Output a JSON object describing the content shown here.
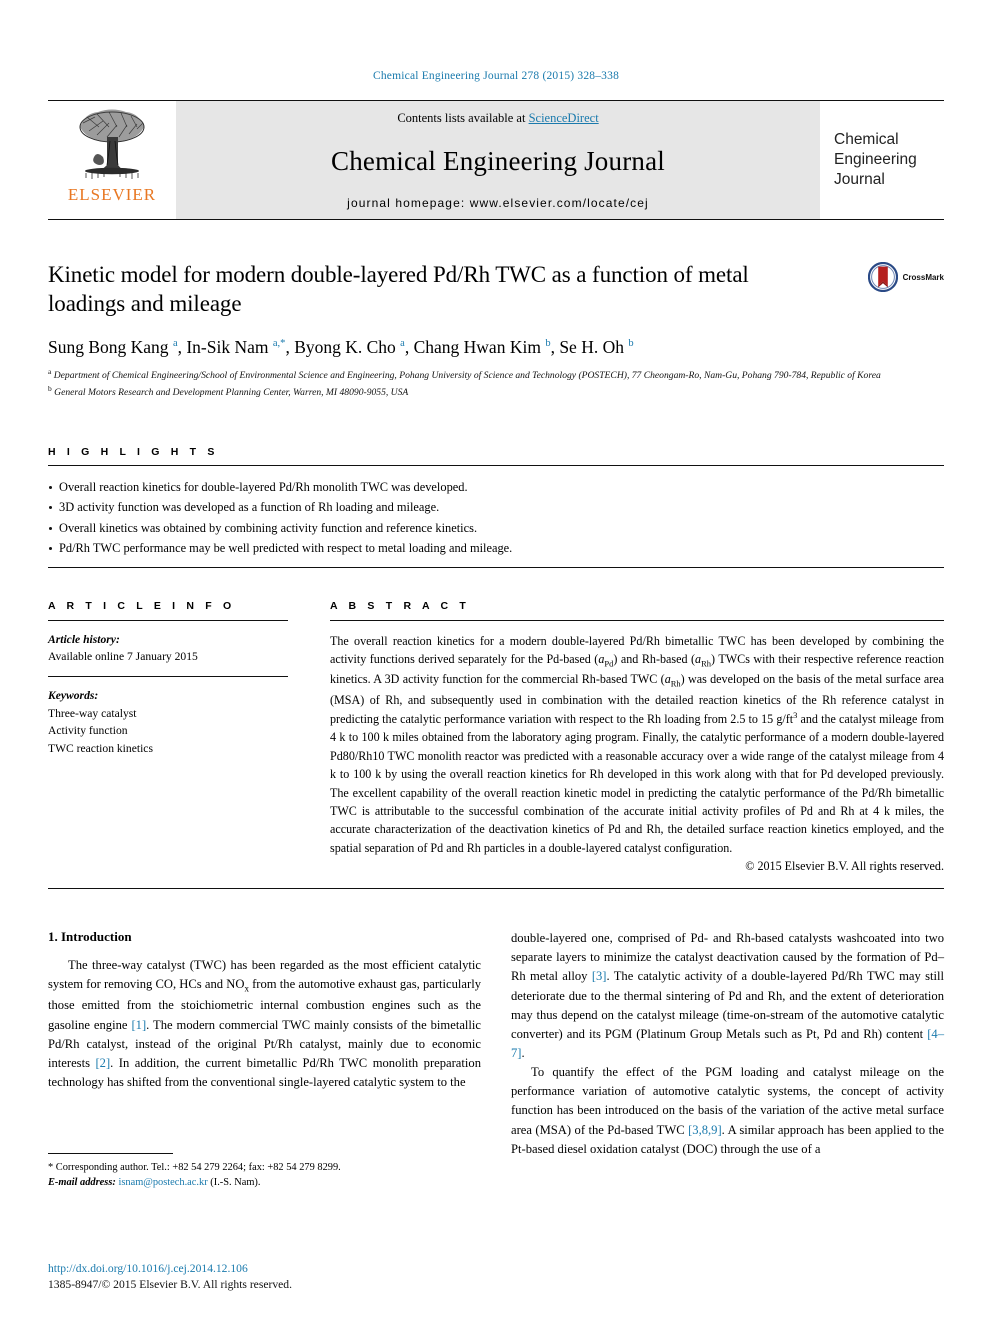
{
  "running_head": "Chemical Engineering Journal 278 (2015) 328–338",
  "masthead": {
    "contents_prefix": "Contents lists available at ",
    "sciencedirect": "ScienceDirect",
    "journal_title": "Chemical Engineering Journal",
    "homepage": "journal homepage: www.elsevier.com/locate/cej",
    "publisher": "ELSEVIER",
    "cover_lines": [
      "Chemical",
      "Engineering",
      "Journal"
    ]
  },
  "article": {
    "title": "Kinetic model for modern double-layered Pd/Rh TWC as a function of metal loadings and mileage",
    "crossmark_label": "CrossMark",
    "authors_html": "Sung Bong Kang <sup>a</sup>, In-Sik Nam <sup>a,*</sup>, Byong K. Cho <sup>a</sup>, Chang Hwan Kim <sup>b</sup>, Se H. Oh <sup>b</sup>",
    "affiliations": [
      "<sup>a</sup> Department of Chemical Engineering/School of Environmental Science and Engineering, Pohang University of Science and Technology (POSTECH), 77 Cheongam-Ro, Nam-Gu, Pohang 790-784, Republic of Korea",
      "<sup>b</sup> General Motors Research and Development Planning Center, Warren, MI 48090-9055, USA"
    ]
  },
  "highlights": {
    "heading": "H I G H L I G H T S",
    "items": [
      "Overall reaction kinetics for double-layered Pd/Rh monolith TWC was developed.",
      "3D activity function was developed as a function of Rh loading and mileage.",
      "Overall kinetics was obtained by combining activity function and reference kinetics.",
      "Pd/Rh TWC performance may be well predicted with respect to metal loading and mileage."
    ]
  },
  "article_info": {
    "heading": "A R T I C L E    I N F O",
    "history_label": "Article history:",
    "history_value": "Available online 7 January 2015",
    "keywords_label": "Keywords:",
    "keywords": [
      "Three-way catalyst",
      "Activity function",
      "TWC reaction kinetics"
    ]
  },
  "abstract": {
    "heading": "A B S T R A C T",
    "body_html": "The overall reaction kinetics for a modern double-layered Pd/Rh bimetallic TWC has been developed by combining the activity functions derived separately for the Pd-based (<i>a</i><sub>Pd</sub>) and Rh-based (<i>a</i><sub>Rh</sub>) TWCs with their respective reference reaction kinetics. A 3D activity function for the commercial Rh-based TWC (<i>a</i><sub>Rh</sub>) was developed on the basis of the metal surface area (MSA) of Rh, and subsequently used in combination with the detailed reaction kinetics of the Rh reference catalyst in predicting the catalytic performance variation with respect to the Rh loading from 2.5 to 15 g/ft<sup>3</sup> and the catalyst mileage from 4 k to 100 k miles obtained from the laboratory aging program. Finally, the catalytic performance of a modern double-layered Pd80/Rh10 TWC monolith reactor was predicted with a reasonable accuracy over a wide range of the catalyst mileage from 4 k to 100 k by using the overall reaction kinetics for Rh developed in this work along with that for Pd developed previously. The excellent capability of the overall reaction kinetic model in predicting the catalytic performance of the Pd/Rh bimetallic TWC is attributable to the successful combination of the accurate initial activity profiles of Pd and Rh at 4 k miles, the accurate characterization of the deactivation kinetics of Pd and Rh, the detailed surface reaction kinetics employed, and the spatial separation of Pd and Rh particles in a double-layered catalyst configuration.",
    "copyright": "© 2015 Elsevier B.V. All rights reserved."
  },
  "introduction": {
    "heading": "1. Introduction",
    "left_para_1_html": "The three-way catalyst (TWC) has been regarded as the most efficient catalytic system for removing CO, HCs and NO<sub>x</sub> from the automotive exhaust gas, particularly those emitted from the stoichiometric internal combustion engines such as the gasoline engine <span class=\"ref\">[1]</span>. The modern commercial TWC mainly consists of the bimetallic Pd/Rh catalyst, instead of the original Pt/Rh catalyst, mainly due to economic interests <span class=\"ref\">[2]</span>. In addition, the current bimetallic Pd/Rh TWC monolith preparation technology has shifted from the conventional single-layered catalytic system to the",
    "right_para_1_html": "double-layered one, comprised of Pd- and Rh-based catalysts washcoated into two separate layers to minimize the catalyst deactivation caused by the formation of Pd–Rh metal alloy <span class=\"ref\">[3]</span>. The catalytic activity of a double-layered Pd/Rh TWC may still deteriorate due to the thermal sintering of Pd and Rh, and the extent of deterioration may thus depend on the catalyst mileage (time-on-stream of the automotive catalytic converter) and its PGM (Platinum Group Metals such as Pt, Pd and Rh) content <span class=\"ref\">[4–7]</span>.",
    "right_para_2_html": "To quantify the effect of the PGM loading and catalyst mileage on the performance variation of automotive catalytic systems, the concept of activity function has been introduced on the basis of the variation of the active metal surface area (MSA) of the Pd-based TWC <span class=\"ref\">[3,8,9]</span>. A similar approach has been applied to the Pt-based diesel oxidation catalyst (DOC) through the use of a"
  },
  "footnote": {
    "corresponding_html": "* Corresponding author. Tel.: +82 54 279 2264; fax: +82 54 279 8299.",
    "email_html": "<span class=\"em-ital\">E-mail address:</span> <span class=\"mail-link\">isnam@postech.ac.kr</span> (I.-S. Nam)."
  },
  "footer": {
    "doi": "http://dx.doi.org/10.1016/j.cej.2014.12.106",
    "issn": "1385-8947/© 2015 Elsevier B.V. All rights reserved."
  },
  "colors": {
    "link": "#1a7aad",
    "elsevier_orange": "#e87722",
    "masthead_bg": "#e6e6e6"
  }
}
